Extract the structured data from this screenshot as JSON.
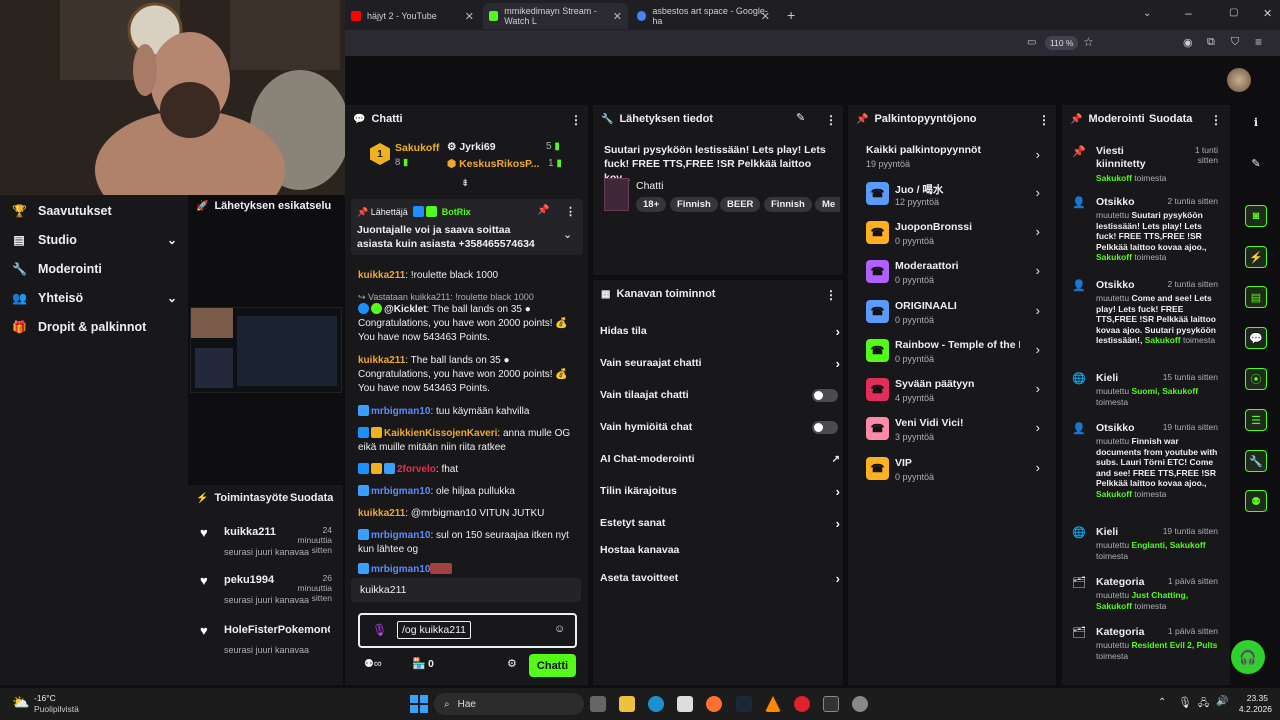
{
  "browser": {
    "tabs": [
      {
        "title": "häjyt 2 - YouTube",
        "color": "#ff0000"
      },
      {
        "title": "mmikedimayn Stream - Watch L",
        "color": "#53fc18"
      },
      {
        "title": "asbestos art space - Google-ha",
        "color": "#4285f4"
      }
    ],
    "zoom": "110 %"
  },
  "sidebar": {
    "items": [
      {
        "label": "Saavutukset",
        "icon": "trophy-icon"
      },
      {
        "label": "Studio",
        "icon": "studio-icon"
      },
      {
        "label": "Moderointi",
        "icon": "wrench-icon"
      },
      {
        "label": "Yhteisö",
        "icon": "community-icon"
      },
      {
        "label": "Dropit & palkinnot",
        "icon": "gift-icon"
      }
    ]
  },
  "preview": {
    "title": "Lähetyksen esikatselu"
  },
  "activity": {
    "title": "Toimintasyöte",
    "filter": "Suodata",
    "items": [
      {
        "user": "kuikka211",
        "time": "24 minuuttia sitten",
        "text": "seurasi juuri kanavaa"
      },
      {
        "user": "peku1994",
        "time": "26 minuuttia sitten",
        "text": "seurasi juuri kanavaa"
      },
      {
        "user": "HoleFisterPokemonGo",
        "time": "",
        "text": "seurasi juuri kanavaa"
      }
    ]
  },
  "chat": {
    "title": "Chatti",
    "leaderboard": [
      {
        "rank": "1",
        "user": "Sakukoff",
        "count": "5",
        "sub": "8"
      },
      {
        "user": "Jyrki69",
        "count": "",
        "sub": ""
      },
      {
        "user": "KeskusRikosP...",
        "count": "1",
        "sub": ""
      }
    ],
    "pinned": {
      "sender_label": "Lähettäjä",
      "sender": "BotRix",
      "text": "Juontajalle voi ja saava soittaa asiasta kuin asiasta +358465574634"
    },
    "messages": [
      {
        "user": "kuikka211",
        "color": "#f0a830",
        "text": ": !roulette black 1000"
      },
      {
        "reply": "Vastataan kuikka211: !roulette black 1000"
      },
      {
        "user": "@Kicklet",
        "color": "#efeff1",
        "text": ": The ball lands on 35 ● Congratulations, you have won 2000 points! 💰 You have now 543463 Points."
      },
      {
        "user": "kuikka211",
        "color": "#f0a830",
        "text": ": The ball lands on 35 ● Congratulations, you have won 2000 points! 💰 You have now 543463 Points."
      },
      {
        "user": "mrbigman10",
        "color": "#5b8cff",
        "text": ": tuu käymään kahvilla"
      },
      {
        "user": "KaikkienKissojenKaveri",
        "color": "#f0a830",
        "text": ": anna mulle OG eikä muille mitään niin riita ratkee"
      },
      {
        "user": "2forvelo",
        "color": "#e0304a",
        "text": ": fhat"
      },
      {
        "user": "mrbigman10",
        "color": "#5b8cff",
        "text": ": ole hiljaa pullukka"
      },
      {
        "user": "kuikka211",
        "color": "#f0a830",
        "text": ": @mrbigman10 VITUN JUTKU"
      },
      {
        "user": "mrbigman10",
        "color": "#5b8cff",
        "text": ": sul on 150 seuraajaa itken nyt kun lähtee og"
      },
      {
        "user": "mrbigman10",
        "color": "#5b8cff",
        "text": ":"
      }
    ],
    "reply_to": "kuikka211",
    "input_value": "/og kuikka211",
    "points": "0",
    "send_label": "Chatti"
  },
  "stream_info": {
    "title": "Lähetyksen tiedot",
    "stream_title": "Suutari pysyköön lestissään! Lets play! Lets fuck! FREE TTS,FREE !SR Pelkkää laittoo kov...",
    "category": "Chatti",
    "tags": [
      "18+",
      "Finnish",
      "BEER",
      "Finnish",
      "Me"
    ]
  },
  "channel_actions": {
    "title": "Kanavan toiminnot",
    "items": [
      {
        "label": "Hidas tila",
        "control": "chevron"
      },
      {
        "label": "Vain seuraajat chatti",
        "control": "chevron"
      },
      {
        "label": "Vain tilaajat chatti",
        "control": "toggle"
      },
      {
        "label": "Vain hymiöitä chat",
        "control": "toggle"
      },
      {
        "label": "AI Chat-moderointi",
        "control": "external"
      },
      {
        "label": "Tilin ikärajoitus",
        "control": "chevron"
      },
      {
        "label": "Estetyt sanat",
        "control": "chevron"
      },
      {
        "label": "Hostaa kanavaa",
        "control": "none"
      },
      {
        "label": "Aseta tavoitteet",
        "control": "chevron"
      }
    ]
  },
  "rewards": {
    "title": "Palkintopyyntöjono",
    "all": {
      "label": "Kaikki palkintopyynnöt",
      "count": "19 pyyntöä"
    },
    "items": [
      {
        "label": "Juo / 喝水",
        "count": "12 pyyntöä",
        "color": "#5b9bff"
      },
      {
        "label": "JuoponBronssi",
        "count": "0 pyyntöä",
        "color": "#ffb020"
      },
      {
        "label": "Moderaattori",
        "count": "0 pyyntöä",
        "color": "#b060ff"
      },
      {
        "label": "ORIGINAALI",
        "count": "0 pyyntöä",
        "color": "#5b9bff"
      },
      {
        "label": "Rainbow - Temple of the King",
        "count": "0 pyyntöä",
        "color": "#53fc18"
      },
      {
        "label": "Syvään päätyyn",
        "count": "4 pyyntöä",
        "color": "#e0305a"
      },
      {
        "label": "Veni Vidi Vici!",
        "count": "3 pyyntöä",
        "color": "#ff8aa8"
      },
      {
        "label": "VIP",
        "count": "0 pyyntöä",
        "color": "#ffb020"
      }
    ]
  },
  "modlog": {
    "title": "Moderointi",
    "filter": "Suodata",
    "entries": [
      {
        "type": "Viesti kiinnitetty",
        "time": "1 tunti sitten",
        "pre": "",
        "hl": "Sakukoff",
        "post": " toimesta"
      },
      {
        "type": "Otsikko",
        "time": "2 tuntia sitten",
        "pre": "muutettu ",
        "hl": "Suutari pysyköön lestissään! Lets play! Lets fuck! FREE TTS,FREE !SR Pelkkää laittoo kovaa ajoo.,",
        "hl2": "Sakukoff",
        "post": " toimesta"
      },
      {
        "type": "Otsikko",
        "time": "2 tuntia sitten",
        "pre": "muutettu ",
        "hl": "Come and see! Lets play! Lets fuck! FREE TTS,FREE !SR Pelkkää laittoo kovaa ajoo. Suutari pysyköön lestissään!,",
        "hl2": "Sakukoff",
        "post": " toimesta"
      },
      {
        "type": "Kieli",
        "time": "15 tuntia sitten",
        "pre": "muutettu ",
        "hl": "Suomi, Sakukoff",
        "post": " toimesta"
      },
      {
        "type": "Otsikko",
        "time": "19 tuntia sitten",
        "pre": "muutettu ",
        "hl": "Finnish war documents from youtube with subs. Lauri Törni ETC! Come and see! FREE TTS,FREE !SR Pelkkää laittoo kovaa ajoo.,",
        "hl2": "Sakukoff",
        "post": " toimesta"
      },
      {
        "type": "Kieli",
        "time": "19 tuntia sitten",
        "pre": "muutettu ",
        "hl": "Englanti, Sakukoff",
        "post": " toimesta"
      },
      {
        "type": "Kategoria",
        "time": "1 päivä sitten",
        "pre": "muutettu ",
        "hl": "Just Chatting, Sakukoff",
        "post": " toimesta"
      },
      {
        "type": "Kategoria",
        "time": "1 päivä sitten",
        "pre": "muutettu ",
        "hl": "Resident Evil 2, Pults",
        "post": " toimesta"
      }
    ]
  },
  "taskbar": {
    "weather_temp": "-16°C",
    "weather_text": "Puolipilvistä",
    "search": "Hae",
    "time": "23.35",
    "date": "4.2.2026"
  }
}
